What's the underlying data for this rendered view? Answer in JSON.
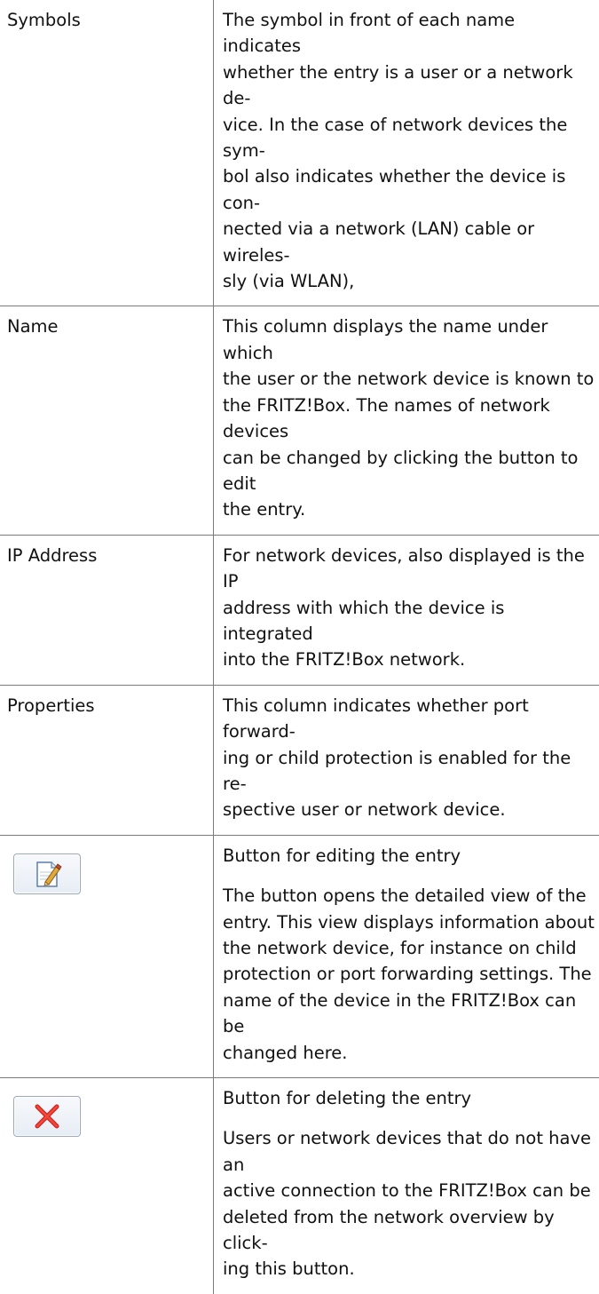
{
  "rows": [
    {
      "label": "Symbols",
      "paragraphs": [
        "The symbol in front of each name indicates whether the entry is a user or a network device. In the case of network devices the symbol also indicates whether the device is connected via a network (LAN) cable or wirelessly (via WLAN),"
      ],
      "lines": [
        "The symbol in front of each name indicates",
        "whether the entry is a user or a network de-",
        "vice. In the case of network devices the sym-",
        "bol also indicates whether the device is con-",
        "nected via a network (LAN) cable or wireles-",
        "sly (via WLAN),"
      ]
    },
    {
      "label": "Name",
      "lines": [
        "This column displays the name under which",
        "the user or the network device is known to",
        "the FRITZ!Box. The names of network devices",
        "can be changed by clicking the button to edit",
        "the entry."
      ]
    },
    {
      "label": "IP Address",
      "lines": [
        "For network devices, also displayed is the IP",
        "address with which the device is integrated",
        "into the FRITZ!Box network."
      ]
    },
    {
      "label": "Properties",
      "lines": [
        "This column indicates whether port forward-",
        "ing or child protection is enabled for the re-",
        "spective user or network device."
      ]
    },
    {
      "icon": "edit-button-icon",
      "title": "Button for editing the entry",
      "lines": [
        "The button opens the detailed view of the",
        "entry. This view displays information about",
        "the network device, for instance on child",
        "protection or port forwarding settings. The",
        "name of the device in the FRITZ!Box can be",
        "changed here."
      ]
    },
    {
      "icon": "delete-button-icon",
      "title": "Button for deleting the entry",
      "lines": [
        "Users or network devices that do not have an",
        "active connection to the FRITZ!Box can be",
        "deleted from the network overview by click-",
        "ing this button."
      ]
    }
  ]
}
